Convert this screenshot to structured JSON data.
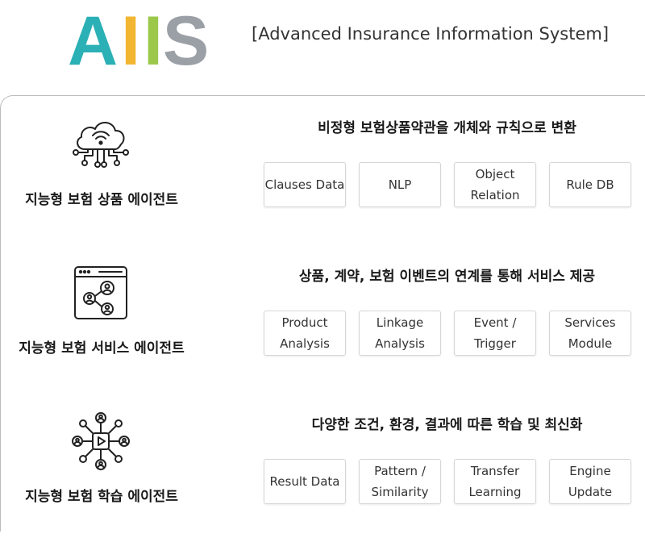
{
  "header": {
    "logo": {
      "letters": [
        "A",
        "I",
        "I",
        "S"
      ],
      "colors": [
        "#2bb0b5",
        "#f2b632",
        "#9bc84b",
        "#9aa0a6"
      ]
    },
    "subtitle": "[Advanced Insurance Information System]"
  },
  "sections": [
    {
      "icon": "cloud-network-icon",
      "title": "지능형 보험 상품 에이전트",
      "heading": "비정형 보험상품약관을 개체와 규칙으로 변환",
      "cards": [
        "Clauses Data",
        "NLP",
        "Object\nRelation",
        "Rule DB"
      ]
    },
    {
      "icon": "browser-share-icon",
      "title": "지능형 보험 서비스 에이전트",
      "heading": "상품, 계약, 보험 이벤트의 연계를 통해 서비스 제공",
      "cards": [
        "Product\nAnalysis",
        "Linkage\nAnalysis",
        "Event /\nTrigger",
        "Services\nModule"
      ]
    },
    {
      "icon": "people-network-icon",
      "title": "지능형 보험 학습 에이전트",
      "heading": "다양한 조건, 환경, 결과에 따른 학습 및 최신화",
      "cards": [
        "Result Data",
        "Pattern /\nSimilarity",
        "Transfer\nLearning",
        "Engine\nUpdate"
      ]
    }
  ]
}
